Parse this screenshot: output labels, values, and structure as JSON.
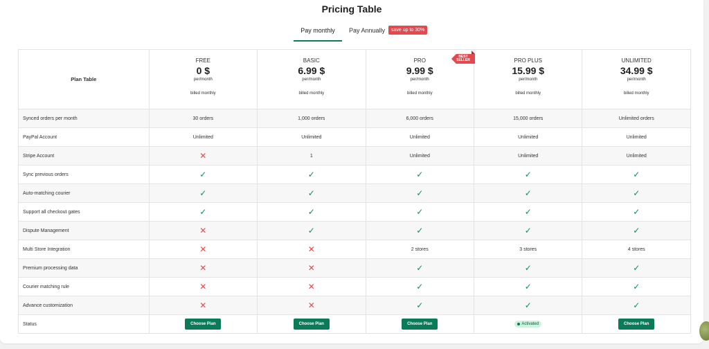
{
  "title": "Pricing Table",
  "billing": {
    "monthly_label": "Pay monthly",
    "annual_label": "Pay Annually",
    "save_badge": "save up to 30%"
  },
  "table": {
    "header_label": "Plan Table",
    "plans": [
      {
        "name": "FREE",
        "price": "0 $",
        "per": "per/month",
        "billed": "billed monthly"
      },
      {
        "name": "BASIC",
        "price": "6.99 $",
        "per": "per/month",
        "billed": "billed monthly"
      },
      {
        "name": "PRO",
        "price": "9.99 $",
        "per": "per/month",
        "billed": "billed monthly",
        "ribbon": "BEST SELLER"
      },
      {
        "name": "PRO PLUS",
        "price": "15.99 $",
        "per": "per/month",
        "billed": "billed monthly"
      },
      {
        "name": "UNLIMITED",
        "price": "34.99 $",
        "per": "per/month",
        "billed": "billed monthly"
      }
    ],
    "rows": [
      {
        "label": "Synced orders per month",
        "cells": [
          "30 orders",
          "1,000 orders",
          "6,000 orders",
          "15,000 orders",
          "Unlimited orders"
        ]
      },
      {
        "label": "PayPal Account",
        "cells": [
          "Unlimited",
          "Unlimited",
          "Unlimited",
          "Unlimited",
          "Unlimited"
        ]
      },
      {
        "label": "Stripe Account",
        "cells": [
          "x",
          "1",
          "Unlimited",
          "Unlimited",
          "Unlimited"
        ]
      },
      {
        "label": "Sync previous orders",
        "cells": [
          "check",
          "check",
          "check",
          "check",
          "check"
        ]
      },
      {
        "label": "Auto-matching courier",
        "cells": [
          "check",
          "check",
          "check",
          "check",
          "check"
        ]
      },
      {
        "label": "Support all checkout gates",
        "cells": [
          "check",
          "check",
          "check",
          "check",
          "check"
        ]
      },
      {
        "label": "Dispute Management",
        "cells": [
          "x",
          "check",
          "check",
          "check",
          "check"
        ]
      },
      {
        "label": "Multi Store Integration",
        "cells": [
          "x",
          "x",
          "2 stores",
          "3 stores",
          "4 stores"
        ]
      },
      {
        "label": "Premium processing data",
        "cells": [
          "x",
          "x",
          "check",
          "check",
          "check"
        ]
      },
      {
        "label": "Courier matching rule",
        "cells": [
          "x",
          "x",
          "check",
          "check",
          "check"
        ]
      },
      {
        "label": "Advance customization",
        "cells": [
          "x",
          "x",
          "check",
          "check",
          "check"
        ]
      }
    ],
    "status": {
      "label": "Status",
      "cells": [
        {
          "type": "button",
          "text": "Choose Plan"
        },
        {
          "type": "button",
          "text": "Choose Plan"
        },
        {
          "type": "button",
          "text": "Choose Plan"
        },
        {
          "type": "badge",
          "text": "Activated"
        },
        {
          "type": "button",
          "text": "Choose Plan"
        }
      ]
    }
  },
  "icons": {
    "check": "check-icon",
    "cross": "cross-icon"
  },
  "colors": {
    "accent": "#0b7b57",
    "danger": "#e5484d",
    "activated_bg": "#cdf3de"
  }
}
